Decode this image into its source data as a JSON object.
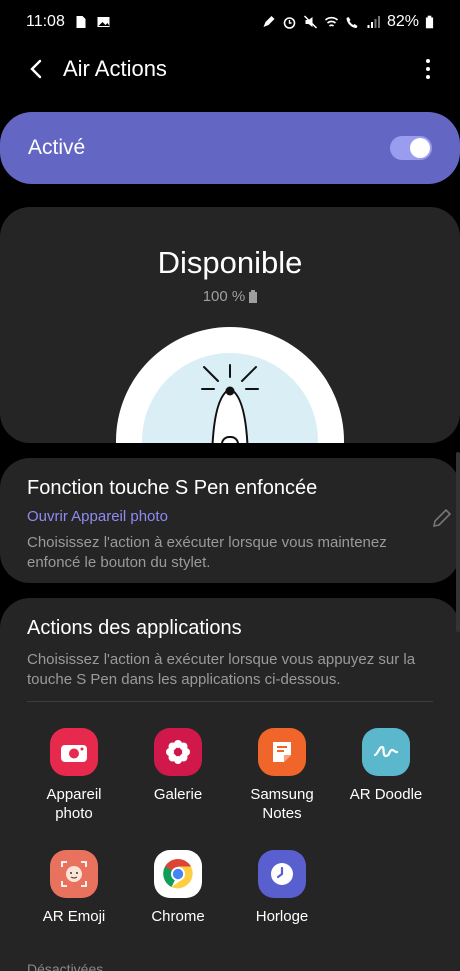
{
  "status_bar": {
    "time": "11:08",
    "battery": "82%"
  },
  "app_bar": {
    "title": "Air Actions"
  },
  "master_toggle": {
    "label": "Activé",
    "on": true
  },
  "pen_status": {
    "title": "Disponible",
    "battery": "100 %"
  },
  "pen_button": {
    "title": "Fonction touche S Pen enfoncée",
    "link": "Ouvrir Appareil photo",
    "description": "Choisissez l'action à exécuter lorsque vous maintenez enfoncé le bouton du stylet."
  },
  "app_actions": {
    "title": "Actions des applications",
    "description": "Choisissez l'action à exécuter lorsque vous appuyez sur la touche S Pen dans les applications ci-dessous.",
    "apps": [
      {
        "label": "Appareil\nphoto",
        "icon": "camera-icon",
        "color": "#e8294e"
      },
      {
        "label": "Galerie",
        "icon": "gallery-flower-icon",
        "color": "#d0194a"
      },
      {
        "label": "Samsung\nNotes",
        "icon": "notes-icon",
        "color": "#f0652a"
      },
      {
        "label": "AR Doodle",
        "icon": "ar-doodle-icon",
        "color": "#5bb7cc"
      },
      {
        "label": "AR Emoji",
        "icon": "ar-emoji-icon",
        "color": "#e9725f"
      },
      {
        "label": "Chrome",
        "icon": "chrome-icon",
        "color": "#ffffff"
      },
      {
        "label": "Horloge",
        "icon": "clock-icon",
        "color": "#5a5fd0"
      }
    ],
    "disabled_label": "Désactivées"
  }
}
